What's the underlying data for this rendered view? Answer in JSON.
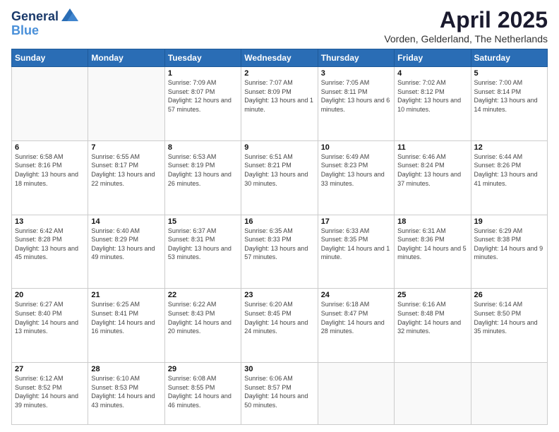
{
  "header": {
    "logo_line1": "General",
    "logo_line2": "Blue",
    "month_title": "April 2025",
    "location": "Vorden, Gelderland, The Netherlands"
  },
  "weekdays": [
    "Sunday",
    "Monday",
    "Tuesday",
    "Wednesday",
    "Thursday",
    "Friday",
    "Saturday"
  ],
  "weeks": [
    [
      {
        "day": "",
        "sunrise": "",
        "sunset": "",
        "daylight": ""
      },
      {
        "day": "",
        "sunrise": "",
        "sunset": "",
        "daylight": ""
      },
      {
        "day": "1",
        "sunrise": "Sunrise: 7:09 AM",
        "sunset": "Sunset: 8:07 PM",
        "daylight": "Daylight: 12 hours and 57 minutes."
      },
      {
        "day": "2",
        "sunrise": "Sunrise: 7:07 AM",
        "sunset": "Sunset: 8:09 PM",
        "daylight": "Daylight: 13 hours and 1 minute."
      },
      {
        "day": "3",
        "sunrise": "Sunrise: 7:05 AM",
        "sunset": "Sunset: 8:11 PM",
        "daylight": "Daylight: 13 hours and 6 minutes."
      },
      {
        "day": "4",
        "sunrise": "Sunrise: 7:02 AM",
        "sunset": "Sunset: 8:12 PM",
        "daylight": "Daylight: 13 hours and 10 minutes."
      },
      {
        "day": "5",
        "sunrise": "Sunrise: 7:00 AM",
        "sunset": "Sunset: 8:14 PM",
        "daylight": "Daylight: 13 hours and 14 minutes."
      }
    ],
    [
      {
        "day": "6",
        "sunrise": "Sunrise: 6:58 AM",
        "sunset": "Sunset: 8:16 PM",
        "daylight": "Daylight: 13 hours and 18 minutes."
      },
      {
        "day": "7",
        "sunrise": "Sunrise: 6:55 AM",
        "sunset": "Sunset: 8:17 PM",
        "daylight": "Daylight: 13 hours and 22 minutes."
      },
      {
        "day": "8",
        "sunrise": "Sunrise: 6:53 AM",
        "sunset": "Sunset: 8:19 PM",
        "daylight": "Daylight: 13 hours and 26 minutes."
      },
      {
        "day": "9",
        "sunrise": "Sunrise: 6:51 AM",
        "sunset": "Sunset: 8:21 PM",
        "daylight": "Daylight: 13 hours and 30 minutes."
      },
      {
        "day": "10",
        "sunrise": "Sunrise: 6:49 AM",
        "sunset": "Sunset: 8:23 PM",
        "daylight": "Daylight: 13 hours and 33 minutes."
      },
      {
        "day": "11",
        "sunrise": "Sunrise: 6:46 AM",
        "sunset": "Sunset: 8:24 PM",
        "daylight": "Daylight: 13 hours and 37 minutes."
      },
      {
        "day": "12",
        "sunrise": "Sunrise: 6:44 AM",
        "sunset": "Sunset: 8:26 PM",
        "daylight": "Daylight: 13 hours and 41 minutes."
      }
    ],
    [
      {
        "day": "13",
        "sunrise": "Sunrise: 6:42 AM",
        "sunset": "Sunset: 8:28 PM",
        "daylight": "Daylight: 13 hours and 45 minutes."
      },
      {
        "day": "14",
        "sunrise": "Sunrise: 6:40 AM",
        "sunset": "Sunset: 8:29 PM",
        "daylight": "Daylight: 13 hours and 49 minutes."
      },
      {
        "day": "15",
        "sunrise": "Sunrise: 6:37 AM",
        "sunset": "Sunset: 8:31 PM",
        "daylight": "Daylight: 13 hours and 53 minutes."
      },
      {
        "day": "16",
        "sunrise": "Sunrise: 6:35 AM",
        "sunset": "Sunset: 8:33 PM",
        "daylight": "Daylight: 13 hours and 57 minutes."
      },
      {
        "day": "17",
        "sunrise": "Sunrise: 6:33 AM",
        "sunset": "Sunset: 8:35 PM",
        "daylight": "Daylight: 14 hours and 1 minute."
      },
      {
        "day": "18",
        "sunrise": "Sunrise: 6:31 AM",
        "sunset": "Sunset: 8:36 PM",
        "daylight": "Daylight: 14 hours and 5 minutes."
      },
      {
        "day": "19",
        "sunrise": "Sunrise: 6:29 AM",
        "sunset": "Sunset: 8:38 PM",
        "daylight": "Daylight: 14 hours and 9 minutes."
      }
    ],
    [
      {
        "day": "20",
        "sunrise": "Sunrise: 6:27 AM",
        "sunset": "Sunset: 8:40 PM",
        "daylight": "Daylight: 14 hours and 13 minutes."
      },
      {
        "day": "21",
        "sunrise": "Sunrise: 6:25 AM",
        "sunset": "Sunset: 8:41 PM",
        "daylight": "Daylight: 14 hours and 16 minutes."
      },
      {
        "day": "22",
        "sunrise": "Sunrise: 6:22 AM",
        "sunset": "Sunset: 8:43 PM",
        "daylight": "Daylight: 14 hours and 20 minutes."
      },
      {
        "day": "23",
        "sunrise": "Sunrise: 6:20 AM",
        "sunset": "Sunset: 8:45 PM",
        "daylight": "Daylight: 14 hours and 24 minutes."
      },
      {
        "day": "24",
        "sunrise": "Sunrise: 6:18 AM",
        "sunset": "Sunset: 8:47 PM",
        "daylight": "Daylight: 14 hours and 28 minutes."
      },
      {
        "day": "25",
        "sunrise": "Sunrise: 6:16 AM",
        "sunset": "Sunset: 8:48 PM",
        "daylight": "Daylight: 14 hours and 32 minutes."
      },
      {
        "day": "26",
        "sunrise": "Sunrise: 6:14 AM",
        "sunset": "Sunset: 8:50 PM",
        "daylight": "Daylight: 14 hours and 35 minutes."
      }
    ],
    [
      {
        "day": "27",
        "sunrise": "Sunrise: 6:12 AM",
        "sunset": "Sunset: 8:52 PM",
        "daylight": "Daylight: 14 hours and 39 minutes."
      },
      {
        "day": "28",
        "sunrise": "Sunrise: 6:10 AM",
        "sunset": "Sunset: 8:53 PM",
        "daylight": "Daylight: 14 hours and 43 minutes."
      },
      {
        "day": "29",
        "sunrise": "Sunrise: 6:08 AM",
        "sunset": "Sunset: 8:55 PM",
        "daylight": "Daylight: 14 hours and 46 minutes."
      },
      {
        "day": "30",
        "sunrise": "Sunrise: 6:06 AM",
        "sunset": "Sunset: 8:57 PM",
        "daylight": "Daylight: 14 hours and 50 minutes."
      },
      {
        "day": "",
        "sunrise": "",
        "sunset": "",
        "daylight": ""
      },
      {
        "day": "",
        "sunrise": "",
        "sunset": "",
        "daylight": ""
      },
      {
        "day": "",
        "sunrise": "",
        "sunset": "",
        "daylight": ""
      }
    ]
  ]
}
